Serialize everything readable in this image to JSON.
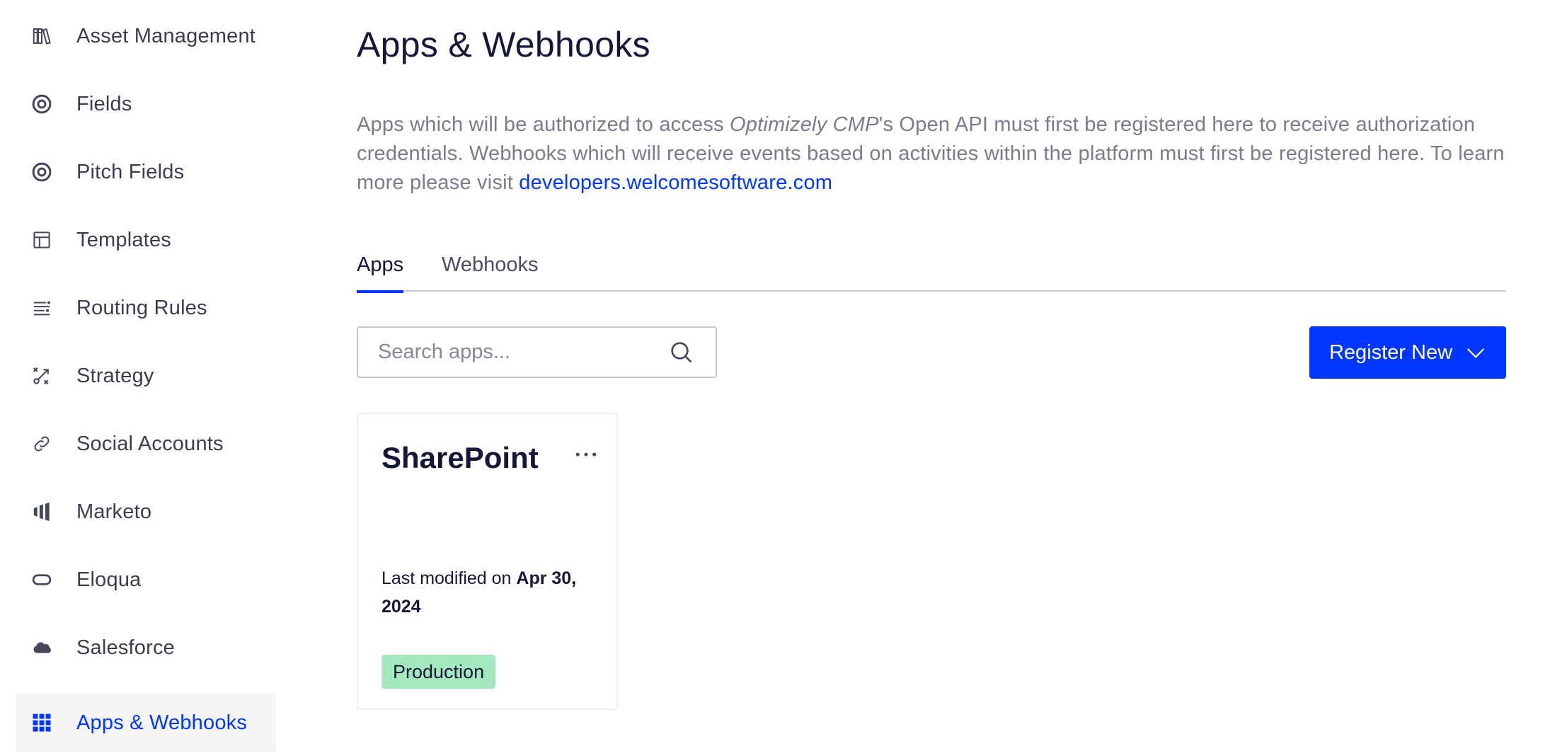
{
  "sidebar": {
    "items": [
      {
        "label": "Asset Management",
        "icon": "books-icon"
      },
      {
        "label": "Fields",
        "icon": "target-icon"
      },
      {
        "label": "Pitch Fields",
        "icon": "target-icon"
      },
      {
        "label": "Templates",
        "icon": "template-icon"
      },
      {
        "label": "Routing Rules",
        "icon": "routing-icon"
      },
      {
        "label": "Strategy",
        "icon": "strategy-icon"
      },
      {
        "label": "Social Accounts",
        "icon": "link-icon"
      },
      {
        "label": "Marketo",
        "icon": "marketo-icon"
      },
      {
        "label": "Eloqua",
        "icon": "eloqua-icon"
      },
      {
        "label": "Salesforce",
        "icon": "cloud-icon"
      },
      {
        "label": "Apps & Webhooks",
        "icon": "grid-icon",
        "active": true
      }
    ]
  },
  "main": {
    "title": "Apps & Webhooks",
    "description": {
      "part1": "Apps which will be authorized to access ",
      "product": "Optimizely CMP",
      "part2": "'s Open API must first be registered here to receive authorization credentials. Webhooks which will receive events based on activities within the platform must first be registered here. To learn more please visit ",
      "link_text": "developers.welcomesoftware.com"
    },
    "tabs": [
      {
        "label": "Apps",
        "active": true
      },
      {
        "label": "Webhooks",
        "active": false
      }
    ],
    "search": {
      "placeholder": "Search apps...",
      "value": ""
    },
    "register_button": "Register New",
    "apps": [
      {
        "name": "SharePoint",
        "modified_prefix": "Last modified on ",
        "modified_date": "Apr 30, 2024",
        "status": "Production"
      }
    ]
  },
  "colors": {
    "accent": "#0037ff",
    "badge_production": "#a3e9bd",
    "text_primary": "#14163a",
    "text_muted": "#797b8f"
  }
}
